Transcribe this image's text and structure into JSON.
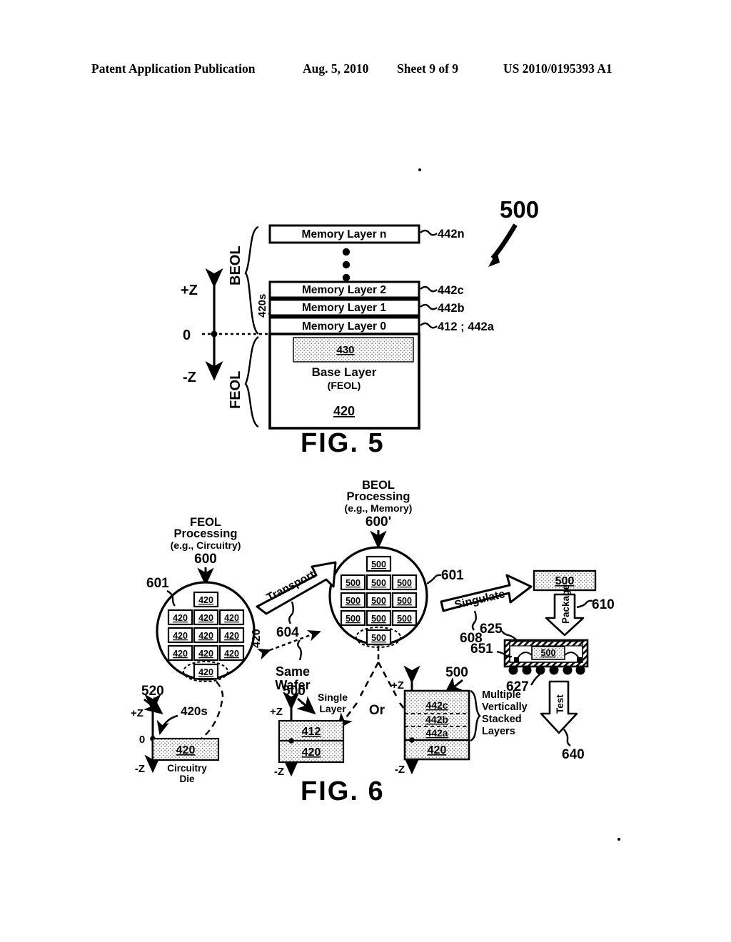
{
  "header": {
    "publication": "Patent Application Publication",
    "date": "Aug. 5, 2010",
    "sheet": "Sheet 9 of 9",
    "number": "US 2010/0195393 A1"
  },
  "figures": [
    {
      "caption": "FIG.  5",
      "ref": "500",
      "axis": {
        "plus": "+Z",
        "zero": "0",
        "minus": "-Z"
      },
      "brackets": [
        {
          "name": "beol",
          "label": "BEOL"
        },
        {
          "name": "feol",
          "label": "FEOL"
        }
      ],
      "callouts": [
        {
          "name": "420s",
          "label": "420s"
        }
      ],
      "layers": [
        {
          "label": "Memory Layer n",
          "ref": "442n"
        },
        {
          "label": "Memory Layer 2",
          "ref": "442c"
        },
        {
          "label": "Memory Layer 1",
          "ref": "442b"
        },
        {
          "label": "Memory Layer 0",
          "ref": "412 ; 442a"
        }
      ],
      "ellipsis_dots": 3,
      "base": {
        "inner_ref": "430",
        "title": "Base Layer",
        "subtitle": "(FEOL)",
        "ref": "420"
      }
    },
    {
      "caption": "FIG.  6",
      "feol_wafer": {
        "title_line1": "FEOL",
        "title_line2": "Processing",
        "title_line3": "(e.g., Circuitry)",
        "ref": "600",
        "edge_ref": "601",
        "die_label": "420",
        "side_ref": "420",
        "die_count": 11
      },
      "beol_wafer": {
        "title_line1": "BEOL",
        "title_line2": "Processing",
        "title_line3": "(e.g., Memory)",
        "ref": "600'",
        "edge_ref": "601",
        "die_label": "500",
        "die_count": 11
      },
      "transport": {
        "label": "Transport",
        "ref": "604"
      },
      "same_wafer": {
        "line1": "Same",
        "line2": "Wafer"
      },
      "singulate": {
        "label": "Singulate",
        "ref": "608"
      },
      "singulated_die": {
        "label": "500"
      },
      "package_arrow": {
        "label": "Package",
        "ref": "610"
      },
      "package": {
        "die_label": "500",
        "refs": [
          "625",
          "651",
          "627"
        ]
      },
      "test_arrow": {
        "label": "Test",
        "ref": "640"
      },
      "circuitry_die": {
        "ref": "520",
        "callout": "420s",
        "axis": {
          "plus": "+Z",
          "zero": "0",
          "minus": "-Z"
        },
        "label": "420",
        "caption_line1": "Circuitry",
        "caption_line2": "Die"
      },
      "single_layer": {
        "ref": "500",
        "caption_line1": "Single",
        "caption_line2": "Layer",
        "axis": {
          "plus": "+Z",
          "minus": "-Z"
        },
        "top_label": "412",
        "bottom_label": "420"
      },
      "or_label": "Or",
      "stacked": {
        "ref": "500",
        "axis": {
          "plus": "+Z",
          "minus": "-Z"
        },
        "layers": [
          "442c",
          "442b",
          "442a"
        ],
        "base": "420",
        "bracket_text": [
          "Multiple",
          "Vertically",
          "Stacked",
          "Layers"
        ]
      }
    }
  ]
}
